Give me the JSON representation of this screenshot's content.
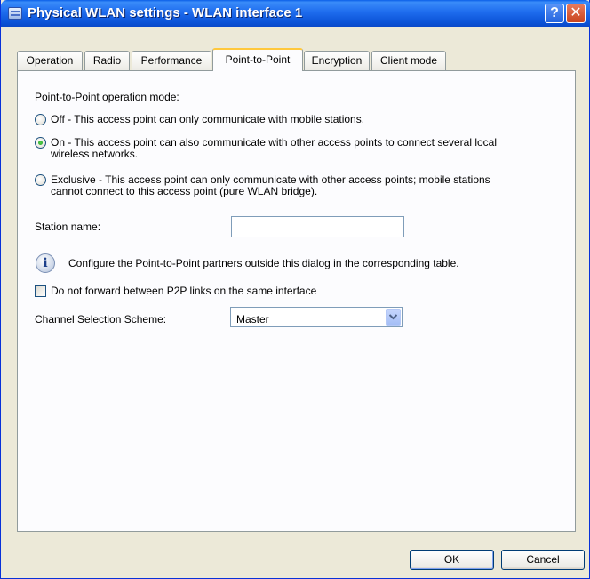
{
  "window": {
    "title": "Physical WLAN settings - WLAN interface 1",
    "help_label": "?",
    "close_label": "✕"
  },
  "tabs": [
    {
      "label": "Operation",
      "active": false
    },
    {
      "label": "Radio",
      "active": false
    },
    {
      "label": "Performance",
      "active": false
    },
    {
      "label": "Point-to-Point",
      "active": true
    },
    {
      "label": "Encryption",
      "active": false
    },
    {
      "label": "Client mode",
      "active": false
    }
  ],
  "p2p": {
    "mode_heading": "Point-to-Point operation mode:",
    "options": [
      {
        "lines": [
          "Off - This access point can only communicate with mobile stations."
        ],
        "checked": false
      },
      {
        "lines": [
          "On - This access point can also communicate with other access points to connect several local",
          "wireless networks."
        ],
        "checked": true
      },
      {
        "lines": [
          "Exclusive - This access point can only communicate with other access points; mobile stations",
          "cannot connect to this access point (pure WLAN bridge)."
        ],
        "checked": false
      }
    ],
    "station_name_label": "Station name:",
    "station_name_value": "",
    "info_text": "Configure the Point-to-Point partners outside this dialog in the corresponding table.",
    "info_icon_glyph": "i",
    "no_forward_label": "Do not forward between P2P links on the same interface",
    "no_forward_checked": false,
    "channel_scheme_label": "Channel Selection Scheme:",
    "channel_scheme_value": "Master"
  },
  "buttons": {
    "ok": "OK",
    "cancel": "Cancel"
  },
  "colors": {
    "titlebar": "#0B52D6",
    "active_tab_accent": "#FFC83C",
    "radio_checked": "#21A121"
  }
}
